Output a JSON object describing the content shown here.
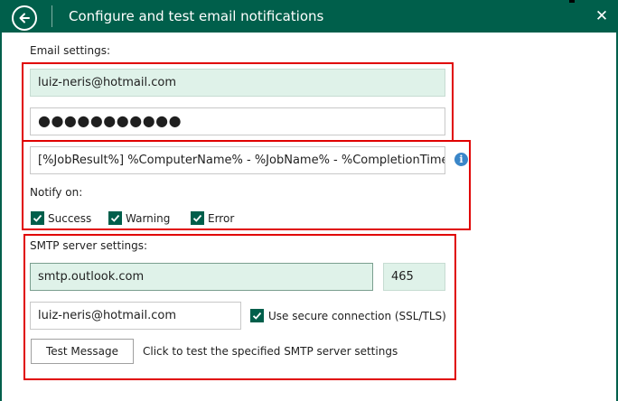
{
  "window": {
    "title": "Configure and test email notifications",
    "close_glyph": "✕"
  },
  "email_settings": {
    "section_label": "Email settings:",
    "email_value": "luiz-neris@hotmail.com",
    "password_mask": "●●●●●●●●●●●"
  },
  "notification": {
    "subject_value": "[%JobResult%] %ComputerName% - %JobName% - %CompletionTime%",
    "info_glyph": "i",
    "notify_label": "Notify on:",
    "options": [
      {
        "label": "Success",
        "checked": true
      },
      {
        "label": "Warning",
        "checked": true
      },
      {
        "label": "Error",
        "checked": true
      }
    ]
  },
  "smtp": {
    "section_label": "SMTP server settings:",
    "server_value": "smtp.outlook.com",
    "port_value": "465",
    "username_value": "luiz-neris@hotmail.com",
    "ssl_label": "Use secure connection (SSL/TLS)",
    "ssl_checked": true,
    "test_button_label": "Test Message",
    "test_hint": "Click to test the specified SMTP server settings"
  },
  "colors": {
    "brand": "#005f4b",
    "field_tint": "#dff2e9",
    "highlight": "#e00000",
    "info": "#3a86c8"
  },
  "icons": {
    "back": "back-arrow-icon",
    "close": "close-icon",
    "info": "info-icon",
    "check": "checkmark-icon"
  }
}
